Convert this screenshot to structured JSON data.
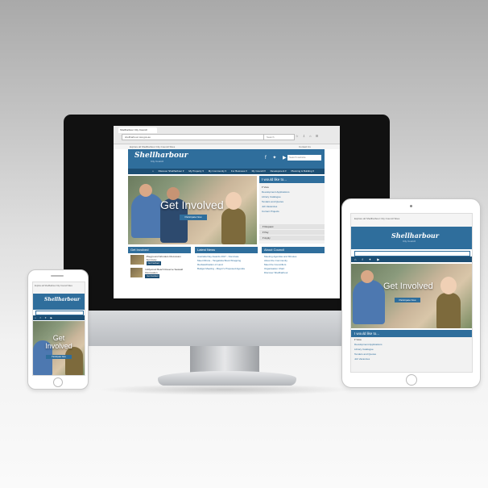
{
  "browser": {
    "tab": "Shellharbour City Council",
    "url": "shellharbour.nsw.gov.au",
    "search": "Search",
    "toolbar_icons": "☆ ⇩ ⌂ ☰",
    "topstrip": "Explore all Shellharbour City Council Sites",
    "topstrip_right": "Contact Us"
  },
  "site": {
    "logo": "Shellharbour",
    "logo_sub": "City Council",
    "social_icons": "f ✦ ▶",
    "search_placeholder": "Search website",
    "nav": [
      "⌂",
      "Discover Shellharbour ▾",
      "My Property ▾",
      "My Community ▾",
      "For Business ▾",
      "My Council ▾",
      "Development ▾",
      "Planning & Building ▾"
    ],
    "hero_title": "Get Involved",
    "hero_button": "Participate Now",
    "sidebar_title": "I would like to...",
    "sidebar_links": [
      "▾ View",
      "Development Applications",
      "Library Catalogue",
      "Tenders and Quotes",
      "Job Vacancies",
      "Current Projects"
    ],
    "sidebar_actions": [
      "▾ Request",
      "▾ Pay",
      "▾ Apply"
    ],
    "col_get_involved": {
      "title": "Get Involved",
      "items": [
        {
          "text": "Playground Wonders Discussion Summary",
          "btn": "Get Involved"
        },
        {
          "text": "Hollywood Beach Reserve Seawall Renovation",
          "btn": "Get Involved"
        }
      ]
    },
    "col_news": {
      "title": "Latest News",
      "items": [
        "Australia Day Awards 2017 - Nominate",
        "Meet Minnie - Tangalotta Book Wrapping",
        "Reclassification of Land",
        "Budget Meeting - Mayor's Proposed Agenda"
      ]
    },
    "col_about": {
      "title": "About Council",
      "items": [
        "Meeting Agendas and Minutes",
        "About the Community",
        "Meet the Councillors",
        "Organisation Chart",
        "Discover Shellharbour"
      ]
    }
  },
  "tablet": {
    "topstrip": "Explore all Shellharbour City Council Sites",
    "nav": "⌂ f ✦ ▶",
    "hero_title": "Get Involved",
    "hero_button": "Participate Now",
    "sidebar_title": "I would like to...",
    "sidebar_links": [
      "▾ View",
      "Development Applications",
      "Library Catalogue",
      "Tenders and Quotes",
      "Job Vacancies"
    ]
  },
  "phone": {
    "topstrip": "Explore all Shellharbour City Council Sites",
    "nav": "⌂ f ✦ ▶",
    "hero_title": "Get Involved",
    "hero_button": "Participate Now"
  },
  "colors": {
    "brand": "#2f6e9c",
    "nav": "#1d4f74"
  }
}
